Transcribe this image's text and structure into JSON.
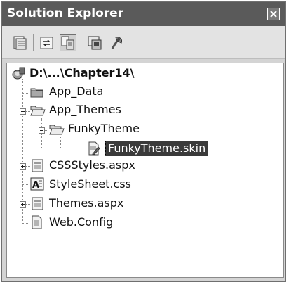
{
  "window": {
    "title": "Solution Explorer"
  },
  "toolbar": {
    "buttons": [
      "properties-icon",
      "refresh-icon",
      "show-all-files-icon",
      "view-code-icon",
      "view-designer-icon"
    ]
  },
  "tree": {
    "root": "D:\\...\\Chapter14\\",
    "items": [
      {
        "label": "App_Data"
      },
      {
        "label": "App_Themes"
      },
      {
        "label": "FunkyTheme"
      },
      {
        "label": "FunkyTheme.skin"
      },
      {
        "label": "CSSStyles.aspx"
      },
      {
        "label": "StyleSheet.css"
      },
      {
        "label": "Themes.aspx"
      },
      {
        "label": "Web.Config"
      }
    ]
  }
}
